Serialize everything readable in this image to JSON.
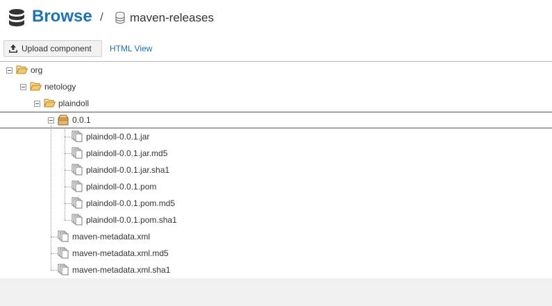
{
  "header": {
    "title": "Browse",
    "separator": "/",
    "repository": "maven-releases"
  },
  "toolbar": {
    "upload_label": "Upload component",
    "html_view_label": "HTML View"
  },
  "tree": {
    "org": "org",
    "netology": "netology",
    "plaindoll": "plaindoll",
    "version": "0.0.1",
    "version_files": [
      "plaindoll-0.0.1.jar",
      "plaindoll-0.0.1.jar.md5",
      "plaindoll-0.0.1.jar.sha1",
      "plaindoll-0.0.1.pom",
      "plaindoll-0.0.1.pom.md5",
      "plaindoll-0.0.1.pom.sha1"
    ],
    "metadata_files": [
      "maven-metadata.xml",
      "maven-metadata.xml.md5",
      "maven-metadata.xml.sha1"
    ]
  },
  "colors": {
    "accent": "#1b72b5",
    "folder": "#f3c96a",
    "component": "#d9a85a"
  },
  "icons": {
    "header": "database-icon",
    "repository": "repository-icon",
    "upload": "upload-icon",
    "folder": "folder-open-icon",
    "component": "component-box-icon",
    "file": "file-asset-icon"
  }
}
